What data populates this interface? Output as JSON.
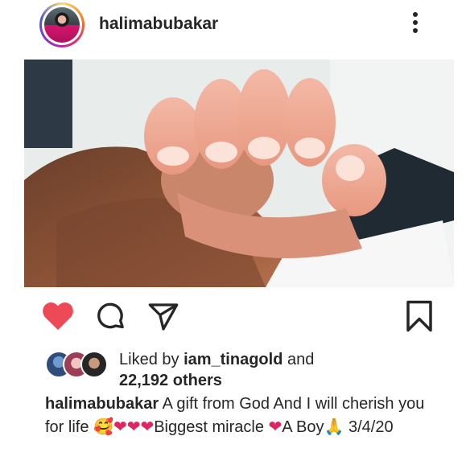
{
  "post": {
    "username": "halimabubakar",
    "liked_prefix": "Liked by ",
    "liked_user": "iam_tinagold",
    "liked_mid": " and",
    "liked_count": "22,192 others",
    "caption_user": "halimabubakar",
    "caption_text": " A gift from God And I will cherish you for life ",
    "caption_emoji1": "🥰",
    "caption_hearts": "❤❤❤",
    "caption_text2": "Biggest miracle ",
    "caption_heart2": "❤",
    "caption_text3": "A Boy",
    "caption_emoji2": "🙏",
    "caption_date": " 3/4/20"
  },
  "icons": {
    "like": "heart-icon",
    "comment": "comment-icon",
    "share": "share-icon",
    "save": "bookmark-icon",
    "more": "more-options-icon"
  },
  "colors": {
    "like_red": "#ed4956",
    "text": "#262626"
  }
}
